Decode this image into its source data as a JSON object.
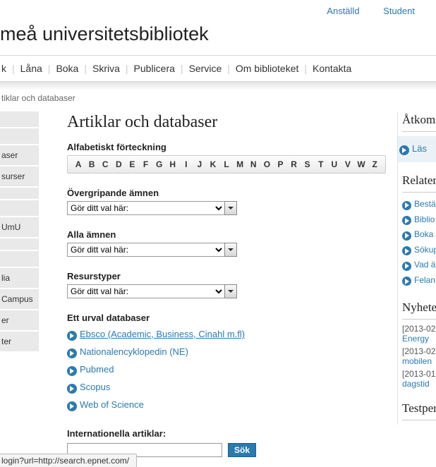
{
  "toplinks": {
    "staff": "Anställd",
    "student": "Student"
  },
  "logo": "meå universitetsbibliotek",
  "nav": [
    "k",
    "Låna",
    "Boka",
    "Skriva",
    "Publicera",
    "Service",
    "Om biblioteket",
    "Kontakta"
  ],
  "breadcrumb": "tiklar och databaser",
  "left": {
    "group2": [
      "aser",
      "surser"
    ],
    "group3": [
      "UmU"
    ],
    "group4": [
      "lia",
      "Campus",
      "er",
      "ter"
    ]
  },
  "page": {
    "title": "Artiklar och databaser",
    "alpha_heading": "Alfabetiskt förteckning",
    "alphabet": [
      "A",
      "B",
      "C",
      "D",
      "E",
      "F",
      "G",
      "H",
      "I",
      "J",
      "K",
      "L",
      "M",
      "N",
      "O",
      "P",
      "R",
      "S",
      "T",
      "U",
      "V",
      "W",
      "Z"
    ],
    "overgripande_label": "Övergripande ämnen",
    "alla_label": "Alla ämnen",
    "resurstyper_label": "Resurstyper",
    "select_placeholder": "Gör ditt val här:",
    "urval_heading": "Ett urval databaser",
    "urval": [
      "Ebsco (Academic, Business, Cinahl m.fl)",
      "Nationalencyklopedin (NE)",
      "Pubmed",
      "Scopus",
      "Web of Science"
    ],
    "intl_label": "Internationella artiklar:",
    "sok": "Sök"
  },
  "right": {
    "atkomst_h": "Åtkomst",
    "las": "Läs",
    "relaterade_h": "Relaterade",
    "rel_links": [
      "Bestä",
      "Biblio",
      "Boka",
      "Sökup",
      "Vad ä",
      "Felan"
    ],
    "nyheter_h": "Nyheter",
    "news": [
      {
        "date": "[2013-02",
        "title": "Energy"
      },
      {
        "date": "[2013-02",
        "title": "mobilen"
      },
      {
        "date": "[2013-01",
        "title": "dagstid"
      }
    ],
    "testpe_h": "Testperiod"
  },
  "statusbar": "login?url=http://search.epnet.com/"
}
